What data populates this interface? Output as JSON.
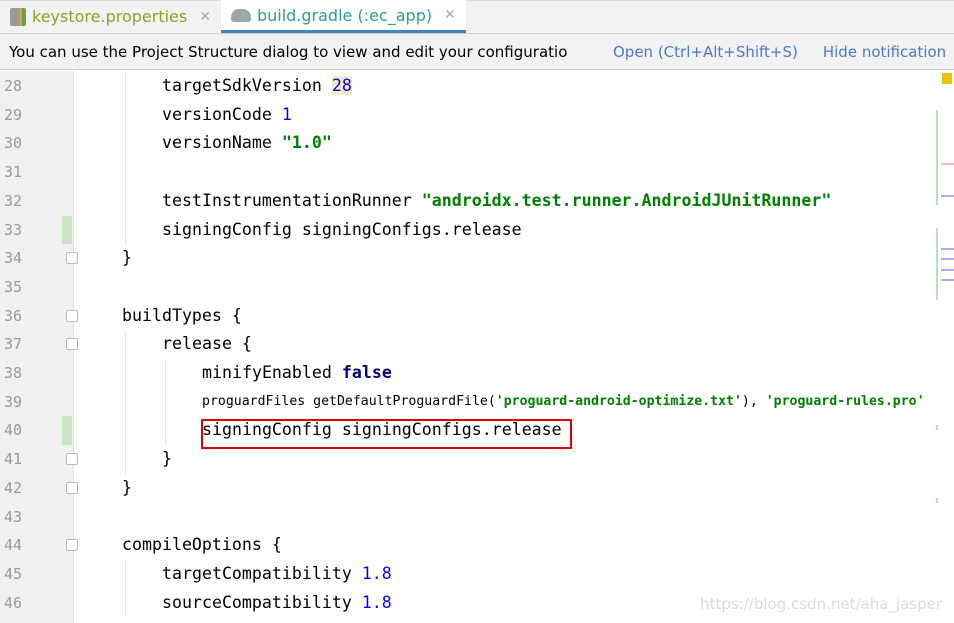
{
  "tabs": [
    {
      "label": "keystore.properties",
      "icon": "properties-file-icon",
      "active": false
    },
    {
      "label": "build.gradle (:ec_app)",
      "icon": "gradle-elephant-icon",
      "active": true
    }
  ],
  "notification": {
    "message": "You can use the Project Structure dialog to view and edit your configuratio",
    "open_label": "Open (Ctrl+Alt+Shift+S)",
    "hide_label": "Hide notification"
  },
  "colors": {
    "accent": "#4083c9",
    "highlight_box": "#e00000",
    "string": "#008000",
    "keyword": "#000080",
    "number": "#0000ff"
  },
  "editor": {
    "lines": [
      {
        "n": "28",
        "indent": 2,
        "tokens": [
          [
            "targetSdkVersion ",
            ""
          ],
          [
            "28",
            "num2 hl"
          ]
        ]
      },
      {
        "n": "29",
        "indent": 2,
        "tokens": [
          [
            "versionCode ",
            ""
          ],
          [
            "1",
            "num2"
          ]
        ]
      },
      {
        "n": "30",
        "indent": 2,
        "tokens": [
          [
            "versionName ",
            ""
          ],
          [
            "\"1.0\"",
            "str"
          ]
        ]
      },
      {
        "n": "31",
        "indent": 0,
        "tokens": []
      },
      {
        "n": "32",
        "indent": 2,
        "tokens": [
          [
            "testInstrumentationRunner ",
            ""
          ],
          [
            "\"androidx.test.runner.AndroidJUnitRunner\"",
            "str"
          ]
        ]
      },
      {
        "n": "33",
        "indent": 2,
        "tokens": [
          [
            "signingConfig signingConfigs.release",
            ""
          ]
        ]
      },
      {
        "n": "34",
        "indent": 1,
        "tokens": [
          [
            "}",
            ""
          ]
        ]
      },
      {
        "n": "35",
        "indent": 0,
        "tokens": []
      },
      {
        "n": "36",
        "indent": 1,
        "tokens": [
          [
            "buildTypes {",
            ""
          ]
        ]
      },
      {
        "n": "37",
        "indent": 2,
        "tokens": [
          [
            "release {",
            ""
          ]
        ]
      },
      {
        "n": "38",
        "indent": 3,
        "tokens": [
          [
            "minifyEnabled ",
            ""
          ],
          [
            "false",
            "kw"
          ]
        ]
      },
      {
        "n": "39",
        "indent": 3,
        "tokens": [
          [
            "proguardFiles getDefaultProguardFile(",
            ""
          ],
          [
            "'proguard-android-optimize.txt'",
            "str"
          ],
          [
            "), ",
            ""
          ],
          [
            "'proguard-rules.pro'",
            "str"
          ]
        ]
      },
      {
        "n": "40",
        "indent": 3,
        "tokens": [
          [
            "signingConfig signingConfigs.release",
            ""
          ]
        ]
      },
      {
        "n": "41",
        "indent": 2,
        "tokens": [
          [
            "}",
            ""
          ]
        ]
      },
      {
        "n": "42",
        "indent": 1,
        "tokens": [
          [
            "}",
            ""
          ]
        ]
      },
      {
        "n": "43",
        "indent": 0,
        "tokens": []
      },
      {
        "n": "44",
        "indent": 1,
        "tokens": [
          [
            "compileOptions {",
            ""
          ]
        ]
      },
      {
        "n": "45",
        "indent": 2,
        "tokens": [
          [
            "targetCompatibility ",
            ""
          ],
          [
            "1.8",
            "num2"
          ]
        ]
      },
      {
        "n": "46",
        "indent": 2,
        "tokens": [
          [
            "sourceCompatibility ",
            ""
          ],
          [
            "1.8",
            "num2"
          ]
        ]
      }
    ]
  },
  "watermark": "https://blog.csdn.net/aha_jasper"
}
